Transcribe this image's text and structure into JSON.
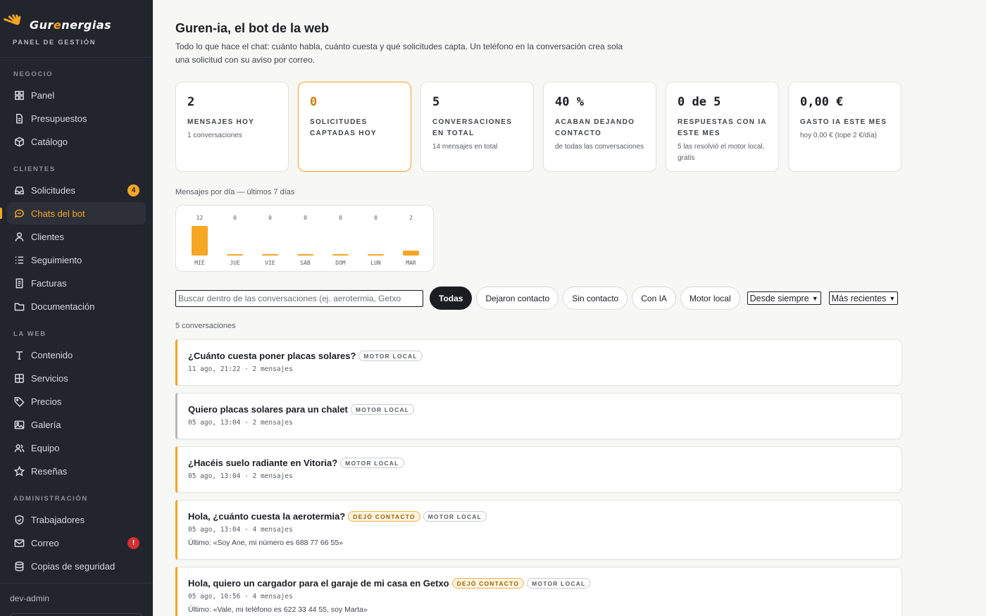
{
  "brand": {
    "logo_prefix": "Gur",
    "logo_highlight": "e",
    "logo_suffix": "nergias",
    "subtitle": "PANEL DE GESTIÓN"
  },
  "sidebar": {
    "sections": [
      {
        "title": "NEGOCIO",
        "items": [
          {
            "label": "Panel",
            "icon": "grid-icon"
          },
          {
            "label": "Presupuestos",
            "icon": "document-icon"
          },
          {
            "label": "Catálogo",
            "icon": "box-icon"
          }
        ]
      },
      {
        "title": "CLIENTES",
        "items": [
          {
            "label": "Solicitudes",
            "icon": "inbox-icon",
            "badge": "4"
          },
          {
            "label": "Chats del bot",
            "icon": "chat-icon",
            "active": true
          },
          {
            "label": "Clientes",
            "icon": "user-icon"
          },
          {
            "label": "Seguimiento",
            "icon": "list-icon"
          },
          {
            "label": "Facturas",
            "icon": "receipt-icon"
          },
          {
            "label": "Documentación",
            "icon": "folder-icon"
          }
        ]
      },
      {
        "title": "LA WEB",
        "items": [
          {
            "label": "Contenido",
            "icon": "text-icon"
          },
          {
            "label": "Servicios",
            "icon": "services-icon"
          },
          {
            "label": "Precios",
            "icon": "tag-icon"
          },
          {
            "label": "Galería",
            "icon": "image-icon"
          },
          {
            "label": "Equipo",
            "icon": "team-icon"
          },
          {
            "label": "Reseñas",
            "icon": "star-icon"
          }
        ]
      },
      {
        "title": "ADMINISTRACIÓN",
        "items": [
          {
            "label": "Trabajadores",
            "icon": "shield-icon"
          },
          {
            "label": "Correo",
            "icon": "mail-icon",
            "badge": "!"
          },
          {
            "label": "Copias de seguridad",
            "icon": "database-icon"
          }
        ]
      }
    ],
    "footer_user": "dev-admin"
  },
  "header": {
    "title": "Guren-ia, el bot de la web",
    "description": "Todo lo que hace el chat: cuánto habla, cuánto cuesta y qué solicitudes capta. Un teléfono en la conversación crea sola una solicitud con su aviso por correo."
  },
  "stats": [
    {
      "value": "2",
      "label": "MENSAJES HOY",
      "sub": "1 conversaciones"
    },
    {
      "value": "0",
      "label": "SOLICITUDES CAPTADAS HOY",
      "sub": "",
      "highlight": true
    },
    {
      "value": "5",
      "label": "CONVERSACIONES EN TOTAL",
      "sub": "14 mensajes en total"
    },
    {
      "value": "40 %",
      "label": "ACABAN DEJANDO CONTACTO",
      "sub": "de todas las conversaciones"
    },
    {
      "value": "0 de 5",
      "label": "RESPUESTAS CON IA ESTE MES",
      "sub": "5 las resolvió el motor local, gratis"
    },
    {
      "value": "0,00 €",
      "label": "GASTO IA ESTE MES",
      "sub": "hoy 0,00 € (tope 2 €/día)"
    }
  ],
  "chart_data": {
    "type": "bar",
    "title": "Mensajes por día — últimos 7 días",
    "categories": [
      "MIÉ",
      "JUE",
      "VIE",
      "SÁB",
      "DOM",
      "LUN",
      "MAR"
    ],
    "values": [
      12,
      0,
      0,
      0,
      0,
      0,
      2
    ],
    "color": "#f5a623"
  },
  "filters": {
    "search_placeholder": "Buscar dentro de las conversaciones (ej. aerotermia, Getxo",
    "chips": [
      "Todas",
      "Dejaron contacto",
      "Sin contacto",
      "Con IA",
      "Motor local"
    ],
    "active_chip": "Todas",
    "period": "Desde siempre",
    "order": "Más recientes"
  },
  "list": {
    "count_text": "5 conversaciones",
    "conversations": [
      {
        "title": "¿Cuánto cuesta poner placas solares?",
        "tags": [
          "MOTOR LOCAL"
        ],
        "meta": "11 ago, 21:22 · 2 mensajes",
        "last": ""
      },
      {
        "title": "Quiero placas solares para un chalet",
        "tags": [
          "MOTOR LOCAL"
        ],
        "meta": "05 ago, 13:04 · 2 mensajes",
        "last": "",
        "grey": true
      },
      {
        "title": "¿Hacéis suelo radiante en Vitoria?",
        "tags": [
          "MOTOR LOCAL"
        ],
        "meta": "05 ago, 13:04 · 2 mensajes",
        "last": ""
      },
      {
        "title": "Hola, ¿cuánto cuesta la aerotermia?",
        "tags": [
          "DEJÓ CONTACTO",
          "MOTOR LOCAL"
        ],
        "meta": "05 ago, 13:04 · 4 mensajes",
        "last": "Último: «Soy Ane, mi número es 688 77 66 55»"
      },
      {
        "title": "Hola, quiero un cargador para el garaje de mi casa en Getxo",
        "tags": [
          "DEJÓ CONTACTO",
          "MOTOR LOCAL"
        ],
        "meta": "05 ago, 10:56 · 4 mensajes",
        "last": "Último: «Vale, mi teléfono es 622 33 44 55, soy Marta»"
      }
    ]
  }
}
